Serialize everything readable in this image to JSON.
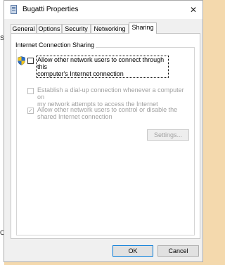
{
  "window": {
    "title": "Bugatti Properties",
    "close_glyph": "✕"
  },
  "tabs": [
    {
      "label": "General"
    },
    {
      "label": "Options"
    },
    {
      "label": "Security"
    },
    {
      "label": "Networking"
    },
    {
      "label": "Sharing"
    }
  ],
  "active_tab": "Sharing",
  "sharing": {
    "group_title": "Internet Connection Sharing",
    "allow_connect_line1": "Allow other network users to connect through this",
    "allow_connect_line2": "computer's Internet connection",
    "allow_connect_checked": false,
    "dialup_line1": "Establish a dial-up connection whenever a computer on",
    "dialup_line2": "my network attempts to access the Internet",
    "dialup_checked": false,
    "control_line1": "Allow other network users to control or disable the",
    "control_line2": "shared Internet connection",
    "control_checked": true,
    "settings_button": "Settings..."
  },
  "footer": {
    "ok_label": "OK",
    "cancel_label": "Cancel"
  },
  "icons": {
    "app": "network-connection-icon",
    "shield": "uac-shield-icon"
  },
  "colors": {
    "titlebar": "#ffffff",
    "window_bg": "#f0f0f0",
    "accent": "#0078d7",
    "disabled_text": "#a0a0a0",
    "desktop": "#f4d9ad"
  }
}
